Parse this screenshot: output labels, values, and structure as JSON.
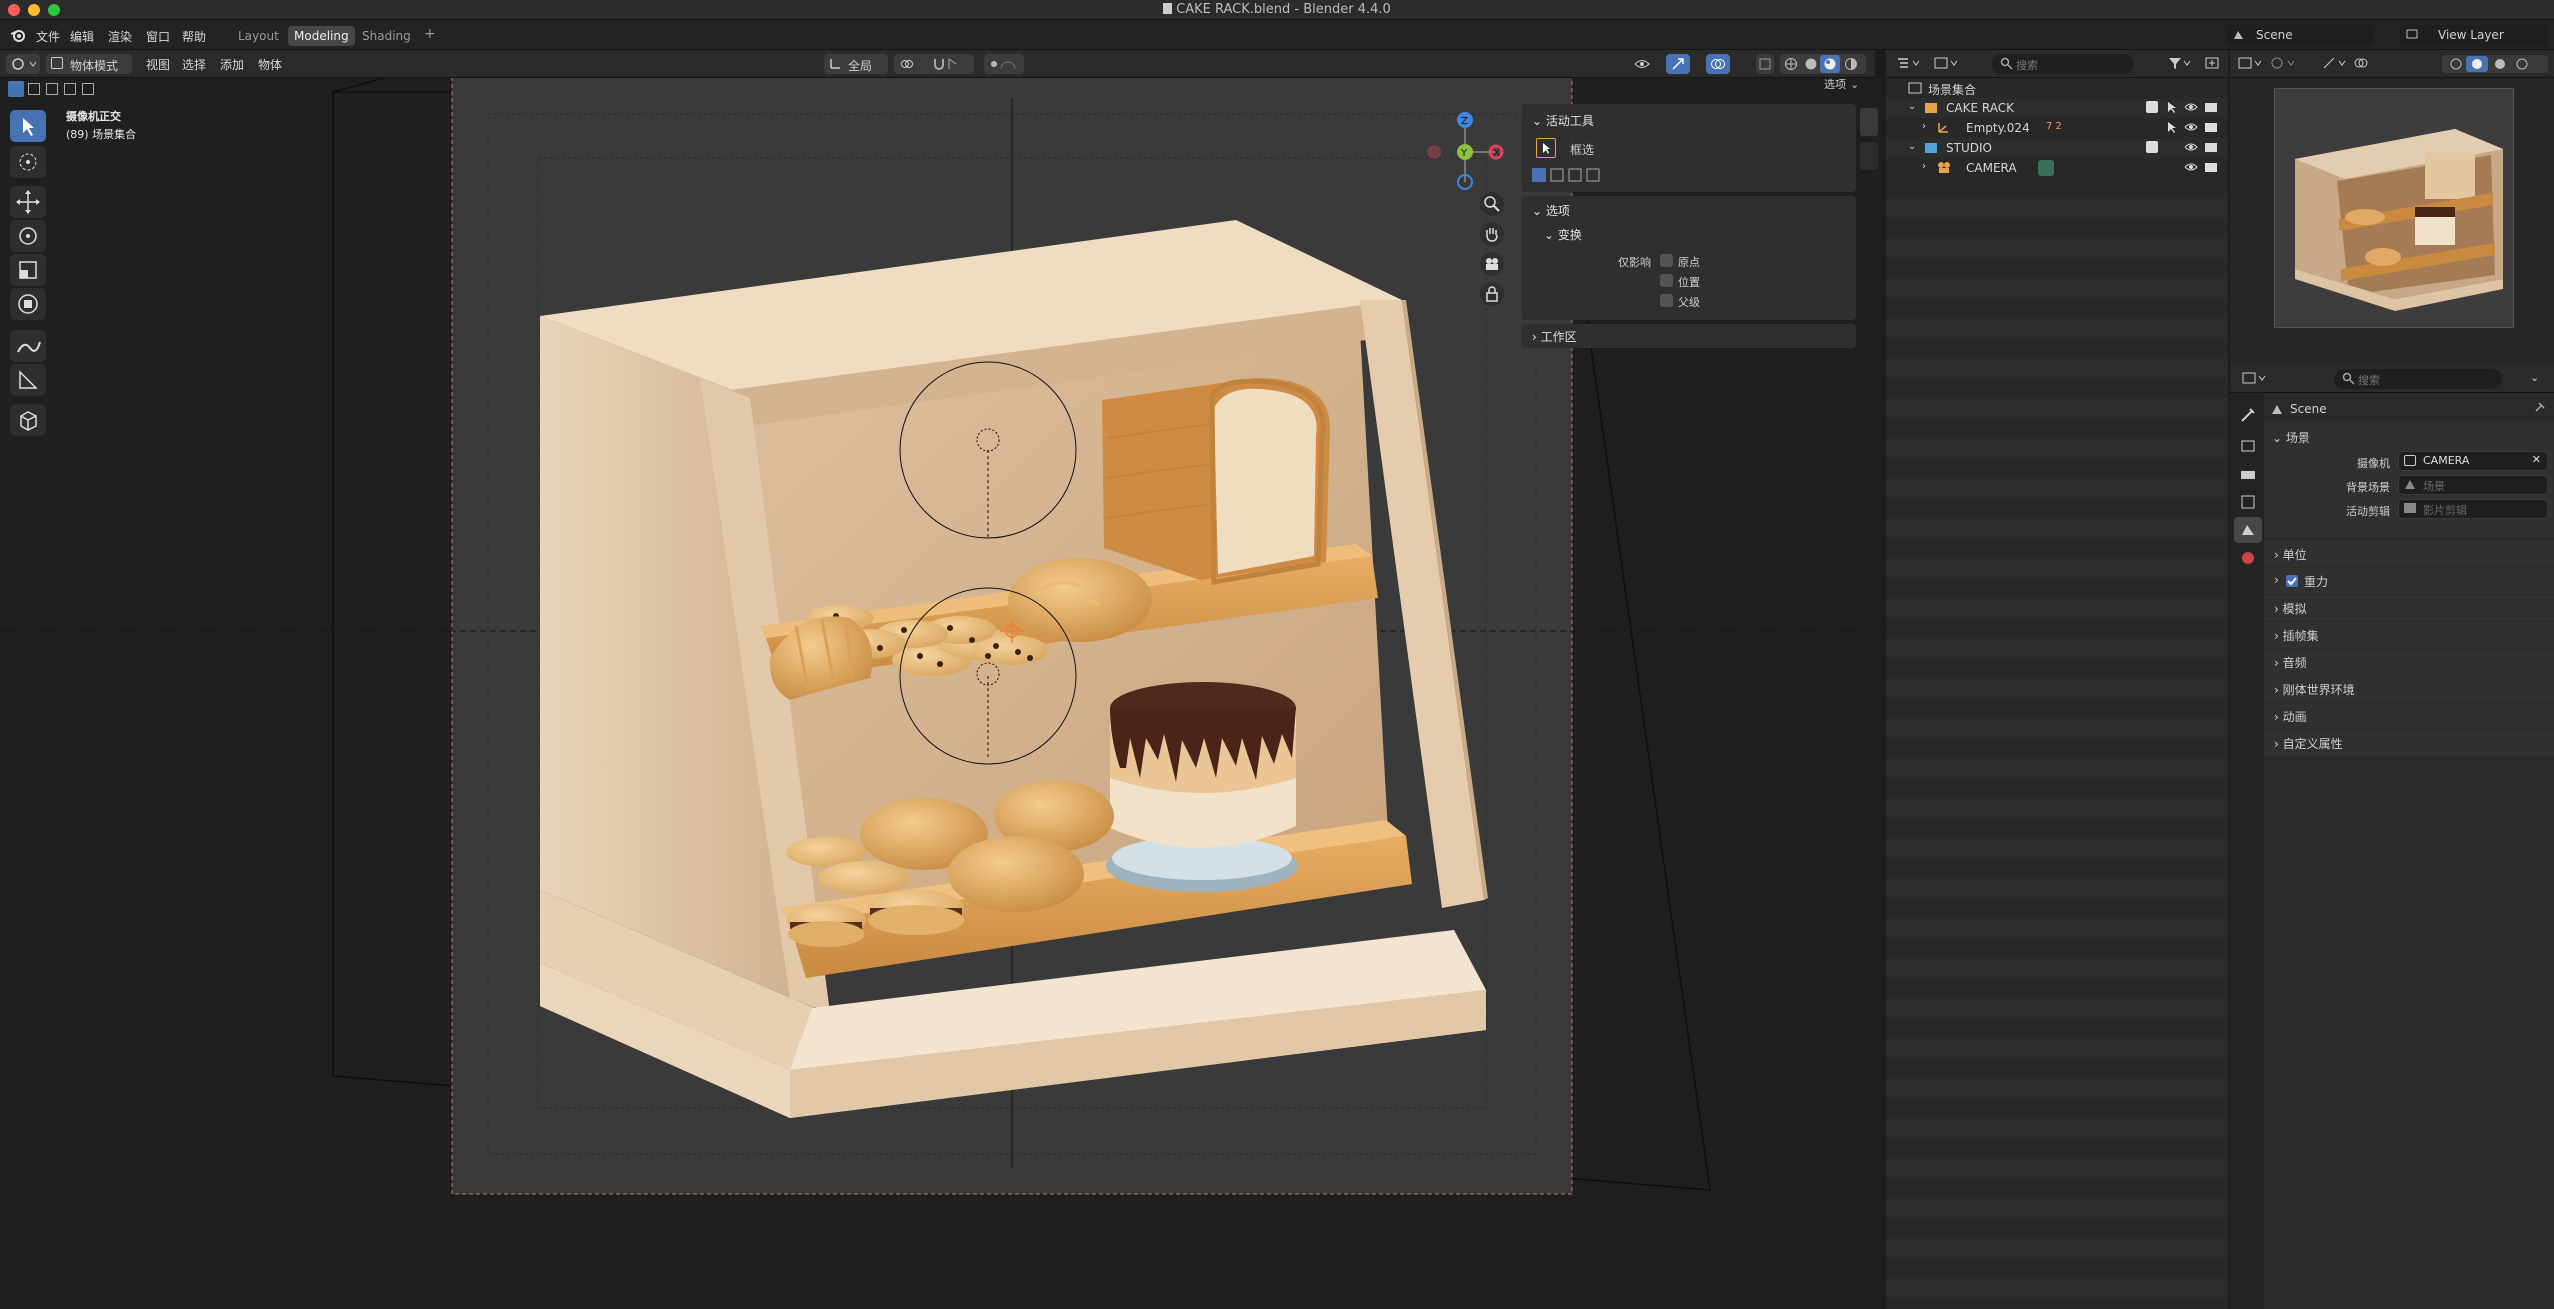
{
  "window": {
    "title": "CAKE RACK.blend - Blender 4.4.0"
  },
  "menubar": {
    "items": [
      "文件",
      "编辑",
      "渲染",
      "窗口",
      "帮助"
    ]
  },
  "workspace_tabs": {
    "tabs": [
      "Layout",
      "Modeling",
      "Shading"
    ],
    "active": "Modeling",
    "add": "+"
  },
  "viewport_header": {
    "mode": "物体模式",
    "menus": [
      "视图",
      "选择",
      "添加",
      "物体"
    ],
    "transform_orientation": "全局",
    "options_label": "选项"
  },
  "viewport": {
    "overlay_line1": "摄像机正交",
    "overlay_line2": "(89) 场景集合"
  },
  "npanel": {
    "active_tool": {
      "header": "活动工具",
      "tool_name": "框选"
    },
    "options": {
      "header": "选项",
      "transform_header": "变换",
      "affect_only_label": "仅影响",
      "checks": [
        "原点",
        "位置",
        "父级"
      ]
    },
    "workspace": {
      "header": "工作区"
    }
  },
  "outliner": {
    "search_placeholder": "搜索",
    "rows": [
      {
        "label": "场景集合",
        "indent": 0
      },
      {
        "label": "CAKE RACK",
        "indent": 1
      },
      {
        "label": "Empty.024",
        "indent": 2
      },
      {
        "label": "STUDIO",
        "indent": 1
      },
      {
        "label": "CAMERA",
        "indent": 2
      }
    ],
    "empty_badge": "7 2"
  },
  "scene_selector": {
    "value": "Scene"
  },
  "view_layer_selector": {
    "value": "View Layer"
  },
  "properties": {
    "search_placeholder": "搜索",
    "context_name": "Scene",
    "scene_section": {
      "header": "场景",
      "camera_label": "摄像机",
      "camera_value": "CAMERA",
      "bg_label": "背景场景",
      "bg_placeholder": "场景",
      "clip_label": "活动剪辑",
      "clip_placeholder": "影片剪辑"
    },
    "sections": [
      "单位",
      "重力",
      "模拟",
      "插帧集",
      "音频",
      "刚体世界环境",
      "动画",
      "自定义属性"
    ]
  },
  "colors": {
    "accent": "#4772b3",
    "shelf_light": "#e6cdb0",
    "shelf_wood": "#d99a4c",
    "chocolate": "#4a2418",
    "axis_x": "#e8495c",
    "axis_y": "#8bc33c",
    "axis_z": "#3f86e3"
  }
}
